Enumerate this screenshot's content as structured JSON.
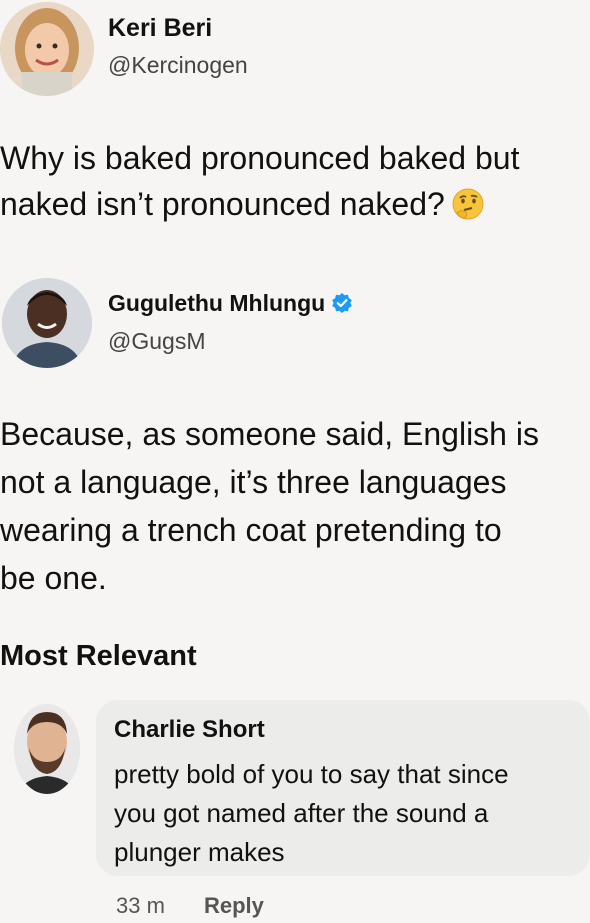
{
  "post": {
    "author_name": "Keri Beri",
    "author_handle": "@Kercinogen",
    "text_line1": "Why is baked pronounced baked but",
    "text_line2": "naked isn’t pronounced naked?",
    "emoji": "thinking-face-emoji"
  },
  "reply": {
    "author_name": "Gugulethu Mhlungu",
    "author_handle": "@GugsM",
    "verified": true,
    "text_line1": "Because, as someone said, English is",
    "text_line2": "not a language, it’s three languages",
    "text_line3": "wearing a trench coat pretending to",
    "text_line4": "be one."
  },
  "section_title": "Most Relevant",
  "comment": {
    "author_name": "Charlie Short",
    "text_line1": "pretty bold of you to say that since",
    "text_line2": "you got named after the sound a",
    "text_line3": "plunger makes",
    "time": "33 m",
    "reply_label": "Reply"
  },
  "colors": {
    "background": "#f6f5f3",
    "bubble": "#ececeb",
    "verified_badge": "#1d9bf0"
  }
}
